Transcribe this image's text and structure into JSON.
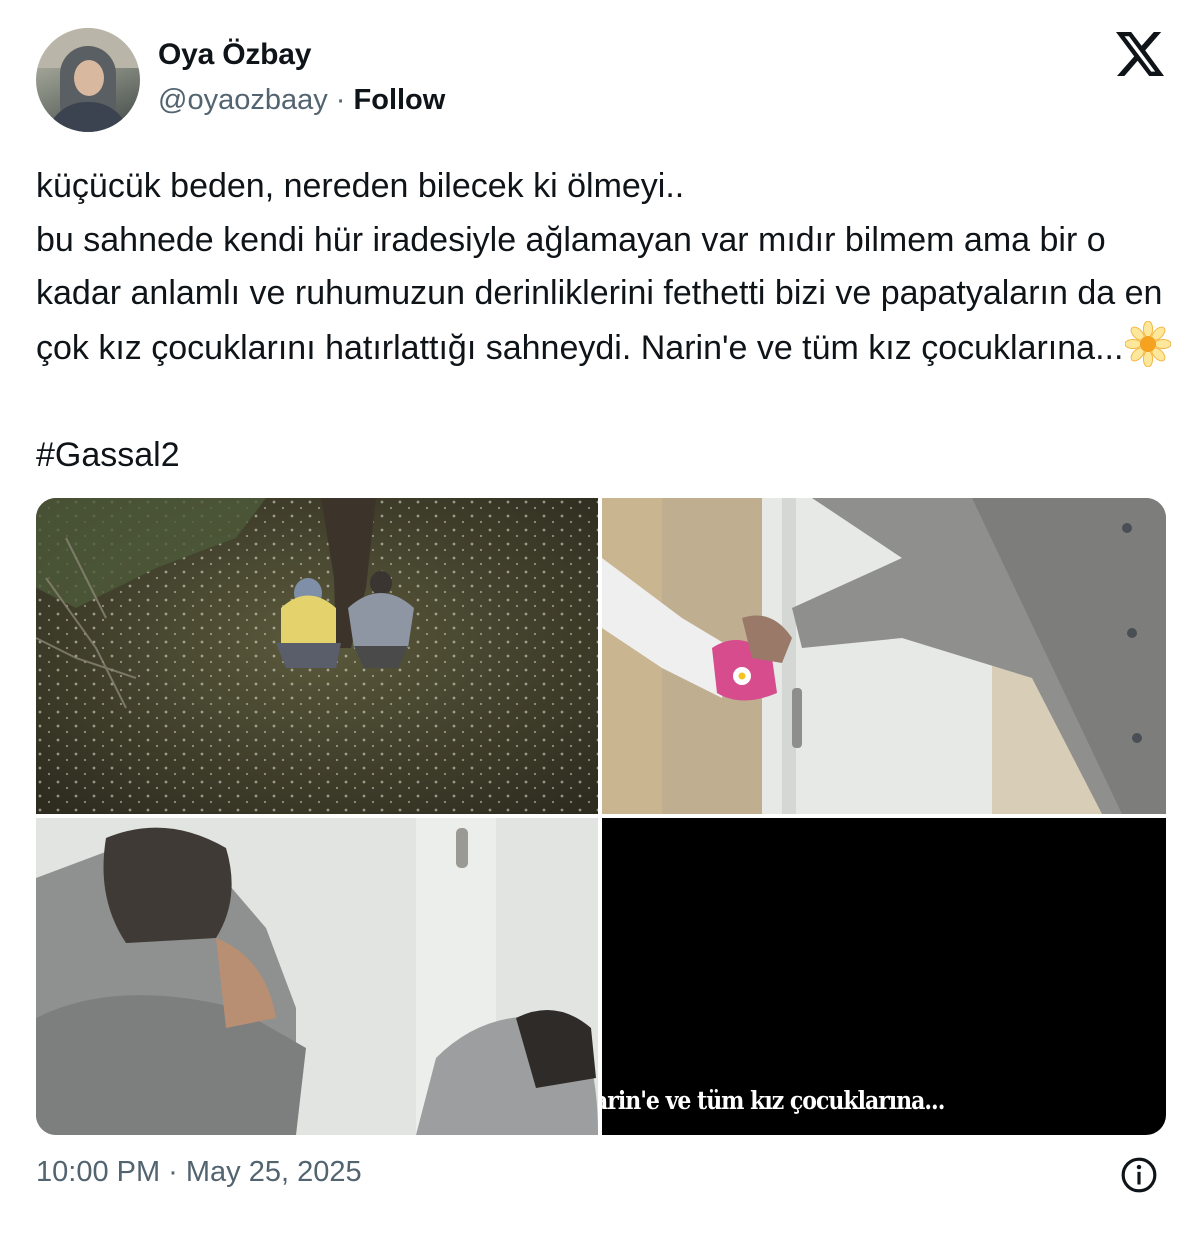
{
  "author": {
    "name": "Oya Özbay",
    "handle": "@oyaozbaay",
    "separator": "·",
    "follow_label": "Follow"
  },
  "icons": {
    "brand": "x-logo-icon",
    "emoji": "daisy-emoji-icon",
    "info": "info-icon"
  },
  "tweet": {
    "text": "küçücük beden, nereden bilecek ki ölmeyi..\nbu sahnede kendi hür iradesiyle ağlamayan var mıdır bilmem ama bir o kadar anlamlı ve ruhumuzun derinliklerini fethetti bizi ve papatyaların da en çok kız çocuklarını hatırlattığı sahneydi. Narin'e ve tüm kız çocuklarına...",
    "hashtag": "#Gassal2"
  },
  "media": {
    "caption": "arin'e ve tüm kız çocuklarına..."
  },
  "timestamp": "10:00 PM · May 25, 2025",
  "colors": {
    "text": "#0f1419",
    "secondary": "#536471"
  }
}
